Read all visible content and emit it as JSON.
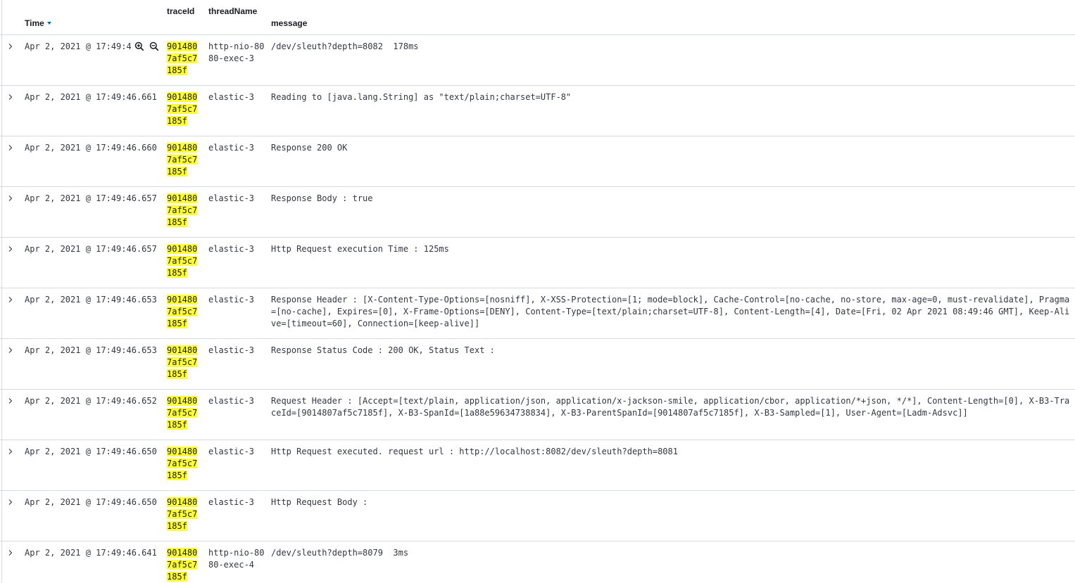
{
  "header": {
    "time": "Time",
    "traceId": "traceId",
    "threadName": "threadName",
    "message": "message"
  },
  "highlight_color": "#ffff33",
  "row_filter_icons": [
    "zoom-in-icon",
    "zoom-out-icon"
  ],
  "rows": [
    {
      "time": "Apr 2, 2021 @ 17:49:46.661",
      "trace": [
        "901480",
        "7af5c7",
        "185f"
      ],
      "thread": "http-nio-8080-exec-3",
      "message": "/dev/sleuth?depth=8082  178ms"
    },
    {
      "time": "Apr 2, 2021 @ 17:49:46.661",
      "trace": [
        "901480",
        "7af5c7",
        "185f"
      ],
      "thread": "elastic-3",
      "message": "Reading to [java.lang.String] as \"text/plain;charset=UTF-8\""
    },
    {
      "time": "Apr 2, 2021 @ 17:49:46.660",
      "trace": [
        "901480",
        "7af5c7",
        "185f"
      ],
      "thread": "elastic-3",
      "message": "Response 200 OK"
    },
    {
      "time": "Apr 2, 2021 @ 17:49:46.657",
      "trace": [
        "901480",
        "7af5c7",
        "185f"
      ],
      "thread": "elastic-3",
      "message": "Response Body : true"
    },
    {
      "time": "Apr 2, 2021 @ 17:49:46.657",
      "trace": [
        "901480",
        "7af5c7",
        "185f"
      ],
      "thread": "elastic-3",
      "message": "Http Request execution Time : 125ms"
    },
    {
      "time": "Apr 2, 2021 @ 17:49:46.653",
      "trace": [
        "901480",
        "7af5c7",
        "185f"
      ],
      "thread": "elastic-3",
      "message": "Response Header : [X-Content-Type-Options=[nosniff], X-XSS-Protection=[1; mode=block], Cache-Control=[no-cache, no-store, max-age=0, must-revalidate], Pragma=[no-cache], Expires=[0], X-Frame-Options=[DENY], Content-Type=[text/plain;charset=UTF-8], Content-Length=[4], Date=[Fri, 02 Apr 2021 08:49:46 GMT], Keep-Alive=[timeout=60], Connection=[keep-alive]]"
    },
    {
      "time": "Apr 2, 2021 @ 17:49:46.653",
      "trace": [
        "901480",
        "7af5c7",
        "185f"
      ],
      "thread": "elastic-3",
      "message": "Response Status Code : 200 OK, Status Text :"
    },
    {
      "time": "Apr 2, 2021 @ 17:49:46.652",
      "trace": [
        "901480",
        "7af5c7",
        "185f"
      ],
      "thread": "elastic-3",
      "message": "Request Header : [Accept=[text/plain, application/json, application/x-jackson-smile, application/cbor, application/*+json, */*], Content-Length=[0], X-B3-TraceId=[9014807af5c7185f], X-B3-SpanId=[1a88e59634738834], X-B3-ParentSpanId=[9014807af5c7185f], X-B3-Sampled=[1], User-Agent=[Ladm-Adsvc]]"
    },
    {
      "time": "Apr 2, 2021 @ 17:49:46.650",
      "trace": [
        "901480",
        "7af5c7",
        "185f"
      ],
      "thread": "elastic-3",
      "message": "Http Request executed. request url : http://localhost:8082/dev/sleuth?depth=8081"
    },
    {
      "time": "Apr 2, 2021 @ 17:49:46.650",
      "trace": [
        "901480",
        "7af5c7",
        "185f"
      ],
      "thread": "elastic-3",
      "message": "Http Request Body :"
    },
    {
      "time": "Apr 2, 2021 @ 17:49:46.641",
      "trace": [
        "901480",
        "7af5c7",
        "185f"
      ],
      "thread": "http-nio-8080-exec-4",
      "message": "/dev/sleuth?depth=8079  3ms"
    }
  ]
}
